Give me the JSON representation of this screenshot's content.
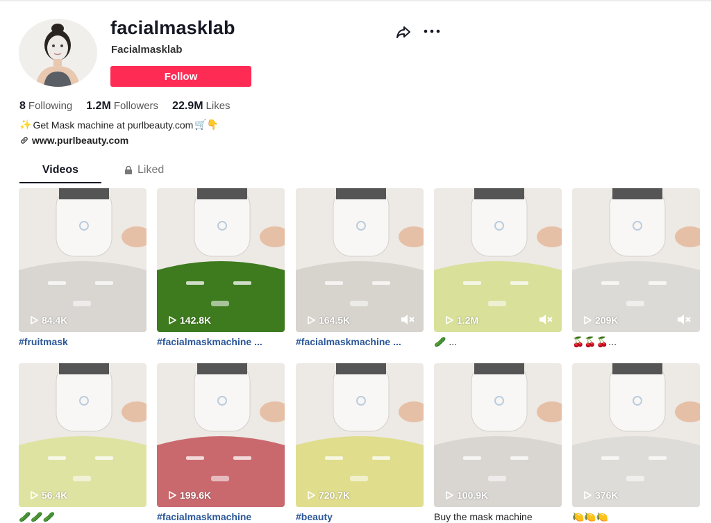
{
  "profile": {
    "username": "facialmasklab",
    "nickname": "Facialmasklab",
    "follow_label": "Follow",
    "stats": [
      {
        "value": "8",
        "label": "Following"
      },
      {
        "value": "1.2M",
        "label": "Followers"
      },
      {
        "value": "22.9M",
        "label": "Likes"
      }
    ],
    "bio": {
      "prefix_emoji": "✨",
      "text": "Get Mask machine at purlbeauty.com",
      "suffix_emoji": "🛒👇"
    },
    "link": "www.purlbeauty.com"
  },
  "header_icons": [
    "share-icon",
    "more-icon"
  ],
  "tabs": [
    {
      "label": "Videos",
      "active": true
    },
    {
      "label": "Liked",
      "locked": true
    }
  ],
  "colors": {
    "accent": "#fe2c55",
    "hashtag": "#2b5797"
  },
  "videos": [
    {
      "views": "84.4K",
      "caption": "#fruitmask",
      "muted": false,
      "mask": "#d9d6d2"
    },
    {
      "views": "142.8K",
      "caption": "#facialmaskmachine ...",
      "muted": false,
      "mask": "#3e7a1e"
    },
    {
      "views": "164.5K",
      "caption": "#facialmaskmachine ...",
      "muted": true,
      "mask": "#d7d3cd"
    },
    {
      "views": "1.2M",
      "caption": "🥒 ...",
      "muted": true,
      "mask": "#d8e09a"
    },
    {
      "views": "209K",
      "caption": "🍒🍒🍒...",
      "muted": true,
      "mask": "#dcdad6"
    },
    {
      "views": "56.4K",
      "caption": "🥒🥒🥒",
      "muted": false,
      "mask": "#dfe3a2"
    },
    {
      "views": "199.6K",
      "caption": "#facialmaskmachine",
      "muted": false,
      "mask": "#c9696e"
    },
    {
      "views": "720.7K",
      "caption": "#beauty",
      "muted": false,
      "mask": "#e0dd8c"
    },
    {
      "views": "100.9K",
      "caption": "Buy the mask machine",
      "muted": false,
      "mask": "#d9d6d2"
    },
    {
      "views": "376K",
      "caption": "🍋🍋🍋",
      "muted": false,
      "mask": "#dedcd8"
    }
  ]
}
